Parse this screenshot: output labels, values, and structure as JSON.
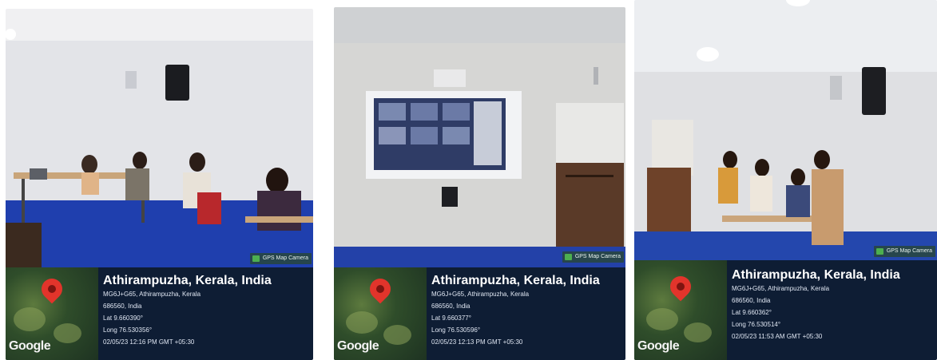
{
  "photos": [
    {
      "badge": "GPS Map Camera",
      "map_logo": "Google",
      "place": "Athirampuzha, Kerala, India",
      "address_line1": "MG6J+G65, Athirampuzha, Kerala",
      "address_line2": "686560, India",
      "lat": "Lat 9.660390°",
      "long": "Long 76.530356°",
      "datetime": "02/05/23 12:16 PM GMT +05:30"
    },
    {
      "badge": "GPS Map Camera",
      "map_logo": "Google",
      "place": "Athirampuzha, Kerala, India",
      "address_line1": "MG6J+G65, Athirampuzha, Kerala",
      "address_line2": "686560, India",
      "lat": "Lat 9.660377°",
      "long": "Long 76.530596°",
      "datetime": "02/05/23 12:13 PM GMT +05:30"
    },
    {
      "badge": "GPS Map Camera",
      "map_logo": "Google",
      "place": "Athirampuzha, Kerala, India",
      "address_line1": "MG6J+G65, Athirampuzha, Kerala",
      "address_line2": "686560, India",
      "lat": "Lat 9.660362°",
      "long": "Long 76.530514°",
      "datetime": "02/05/23 11:53 AM GMT +05:30"
    }
  ]
}
